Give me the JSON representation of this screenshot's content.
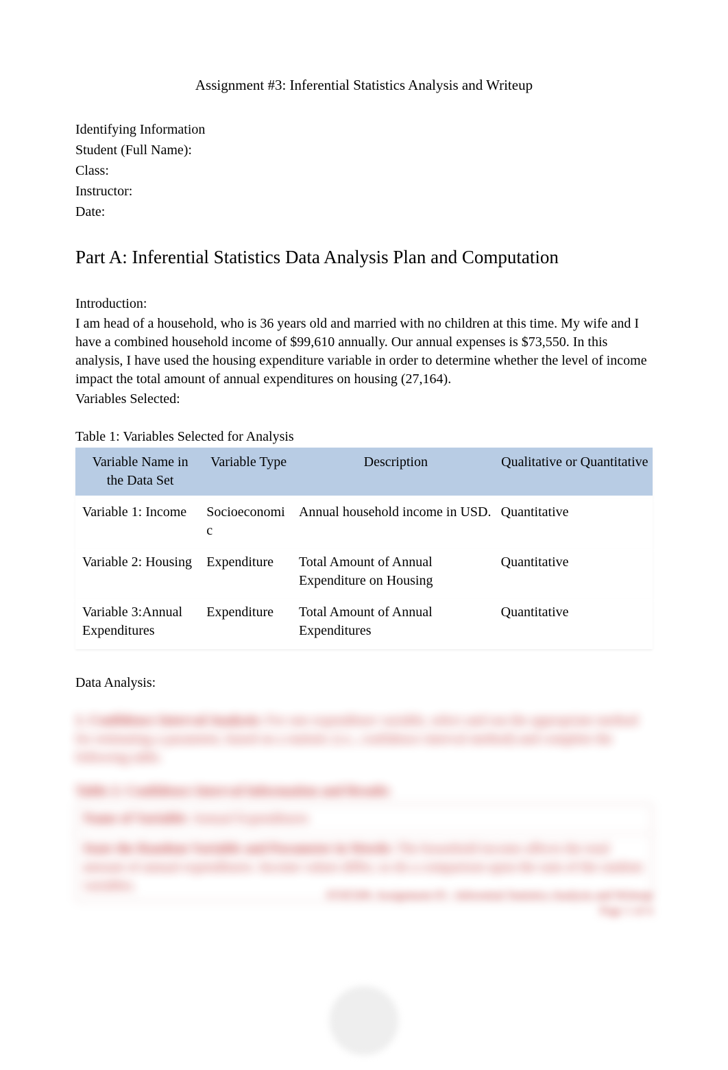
{
  "title": "Assignment #3: Inferential Statistics Analysis and Writeup",
  "ident": {
    "heading": "Identifying Information",
    "student_label": "Student (Full Name):",
    "class_label": "Class:",
    "instructor_label": "Instructor:",
    "date_label": "Date:"
  },
  "part_a_heading": "Part A: Inferential Statistics Data Analysis Plan and Computation",
  "intro": {
    "label": "Introduction:",
    "text": "I am head of a household, who is 36 years old and married with no children at this time. My wife and I have a combined household income of $99,610 annually. Our annual expenses is $73,550. In this analysis, I have used the housing expenditure variable in order to determine whether the level of income impact the total amount of annual expenditures on housing (27,164).",
    "vars_selected": "Variables Selected:"
  },
  "table1": {
    "caption": "Table 1: Variables Selected for Analysis",
    "headers": {
      "c1": "Variable Name in the Data Set",
      "c2": "Variable Type",
      "c3": "Description",
      "c4": "Qualitative or Quantitative"
    },
    "rows": [
      {
        "name": "Variable 1: Income",
        "type": "Socioeconomic",
        "desc": "Annual household income in USD.",
        "qq": "Quantitative"
      },
      {
        "name": "Variable 2: Housing",
        "type": "Expenditure",
        "desc": "Total Amount of Annual Expenditure on Housing",
        "qq": "Quantitative"
      },
      {
        "name": "Variable 3:Annual Expenditures",
        "type": "Expenditure",
        "desc": "Total Amount of Annual Expenditures",
        "qq": "Quantitative"
      }
    ]
  },
  "data_analysis_label": "Data Analysis:",
  "obscured": {
    "ci_line_bold": "1. Confidence Interval Analysis:",
    "ci_line_rest": " For one expenditure variable, select and run the appropriate method for estimating a parameter, based on a statistic (i.e., confidence interval method) and complete the following table.",
    "table2_caption": "Table 2: Confidence Interval Information and Results",
    "row1_label": "Name of Variable:",
    "row1_value": "Annual Expenditures",
    "row2_label": "State the Random Variable and Parameter in Words:",
    "row2_value": " The household income affects the total amount of annual expenditures. Income values differ, so do a comparison upon the sum of the random variables."
  },
  "footer": {
    "line": "STAT200: Assignment #3 - Inferential Statistics Analysis and Writeup",
    "page": "Page 1 of 4"
  }
}
